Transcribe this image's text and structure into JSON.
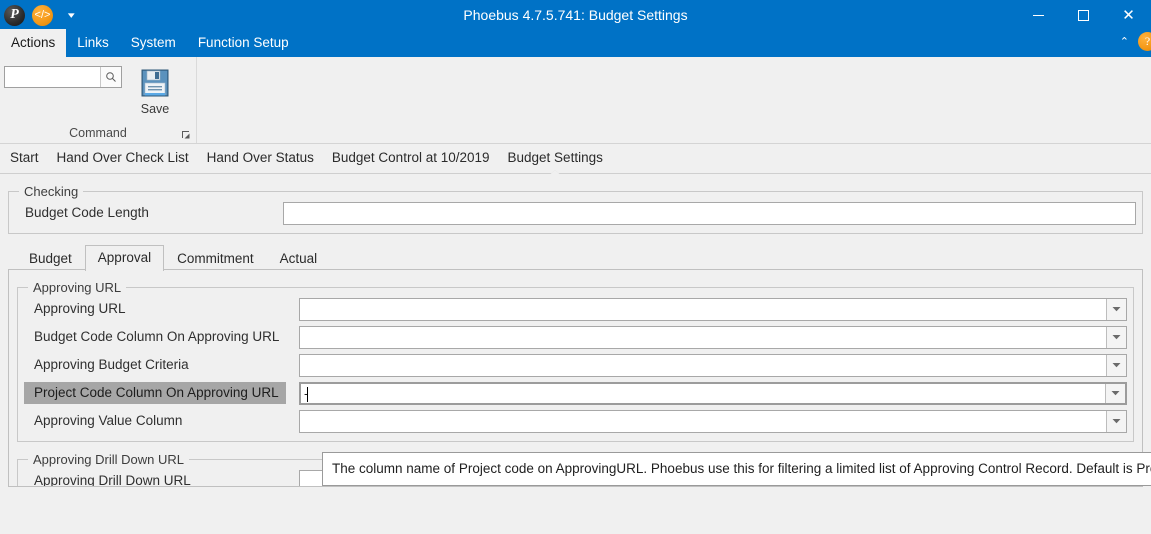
{
  "window": {
    "title": "Phoebus 4.7.5.741: Budget Settings",
    "quick_access": [
      {
        "name": "app-logo-icon",
        "glyph": "P"
      },
      {
        "name": "code-icon",
        "glyph": "</>"
      }
    ],
    "qat_more_glyph": "▾",
    "controls": {
      "minimize": "–",
      "maximize": "□",
      "close": "✕"
    }
  },
  "menubar": {
    "items": [
      {
        "label": "Actions",
        "active": true
      },
      {
        "label": "Links",
        "active": false
      },
      {
        "label": "System",
        "active": false
      },
      {
        "label": "Function Setup",
        "active": false
      }
    ],
    "collapse_glyph": "⌃",
    "help_glyph": "?"
  },
  "ribbon": {
    "search": {
      "value": "",
      "placeholder": ""
    },
    "save_label": "Save",
    "group_label": "Command"
  },
  "doc_tabs": [
    {
      "label": "Start",
      "active": false
    },
    {
      "label": "Hand Over Check List",
      "active": false
    },
    {
      "label": "Hand Over Status",
      "active": false
    },
    {
      "label": "Budget Control at 10/2019",
      "active": false
    },
    {
      "label": "Budget Settings",
      "active": true
    }
  ],
  "checking": {
    "legend": "Checking",
    "budget_code_length_label": "Budget Code Length",
    "budget_code_length_value": ""
  },
  "inner_tabs": [
    {
      "label": "Budget",
      "active": false
    },
    {
      "label": "Approval",
      "active": true
    },
    {
      "label": "Commitment",
      "active": false
    },
    {
      "label": "Actual",
      "active": false
    }
  ],
  "approving_url_group": {
    "legend": "Approving URL",
    "rows": [
      {
        "label": "Approving URL",
        "value": "",
        "highlighted": false,
        "focused": false
      },
      {
        "label": "Budget Code Column On Approving URL",
        "value": "",
        "highlighted": false,
        "focused": false
      },
      {
        "label": "Approving Budget Criteria",
        "value": "",
        "highlighted": false,
        "focused": false
      },
      {
        "label": "Project Code Column On Approving URL",
        "value": "-",
        "highlighted": true,
        "focused": true
      },
      {
        "label": "Approving Value Column",
        "value": "",
        "highlighted": false,
        "focused": false
      }
    ]
  },
  "drilldown_group": {
    "legend": "Approving Drill Down URL",
    "rows": [
      {
        "label": "Approving Drill Down URL",
        "value": "",
        "highlighted": false,
        "focused": false
      }
    ]
  },
  "tooltip": {
    "text": "The column name of Project code on ApprovingURL. Phoebus use this for filtering a limited list of Approving Control Record. Default is Proje"
  },
  "colors": {
    "title_bar": "#0072c6",
    "accent": "#0072c6",
    "chrome_bg": "#f0f0f0",
    "highlight": "#a6a6a6",
    "border": "#c8c8c8"
  }
}
